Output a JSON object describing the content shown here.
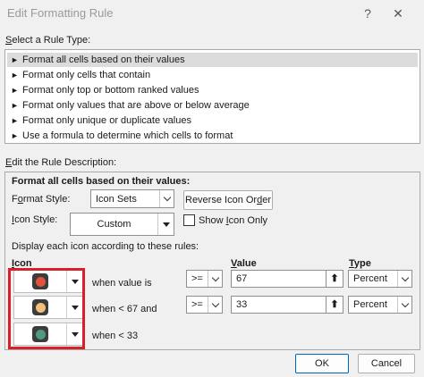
{
  "window": {
    "title": "Edit Formatting Rule",
    "help_glyph": "?",
    "close_glyph": "✕"
  },
  "rule_type": {
    "label_prefix": "",
    "label_ul": "S",
    "label_rest": "elect a Rule Type:",
    "items": [
      "Format all cells based on their values",
      "Format only cells that contain",
      "Format only top or bottom ranked values",
      "Format only values that are above or below average",
      "Format only unique or duplicate values",
      "Use a formula to determine which cells to format"
    ],
    "selected_index": 0,
    "arrow_glyph": "►"
  },
  "description": {
    "label_ul": "E",
    "label_rest": "dit the Rule Description:",
    "heading": "Format all cells based on their values:",
    "format_style_label_pre": "F",
    "format_style_label_ul": "o",
    "format_style_label_post": "rmat Style:",
    "format_style_value": "Icon Sets",
    "reverse_button_pre": "Reverse Icon Or",
    "reverse_button_ul": "d",
    "reverse_button_post": "er",
    "icon_style_label_ul": "I",
    "icon_style_label_rest": "con Style:",
    "icon_style_value": "Custom",
    "show_icon_only_pre": "Show ",
    "show_icon_only_ul": "I",
    "show_icon_only_post": "con Only",
    "show_icon_only_checked": false,
    "display_rules_text": "Display each icon according to these rules:",
    "col_icon_ul": "I",
    "col_icon_rest": "con",
    "col_value_ul": "V",
    "col_value_rest": "alue",
    "col_type_ul": "T",
    "col_type_rest": "ype"
  },
  "rules": [
    {
      "icon": "red-circle-icon",
      "color": "#e0523a",
      "condition": "when value is",
      "operator": ">=",
      "value": "67",
      "type": "Percent"
    },
    {
      "icon": "yellow-circle-icon",
      "color": "#f2c078",
      "condition": "when < 67 and",
      "operator": ">=",
      "value": "33",
      "type": "Percent"
    },
    {
      "icon": "green-circle-icon",
      "color": "#4e9a80",
      "condition": "when < 33",
      "operator": "",
      "value": "",
      "type": ""
    }
  ],
  "footer": {
    "ok_label": "OK",
    "cancel_label": "Cancel"
  },
  "highlight_color": "#d9202a"
}
